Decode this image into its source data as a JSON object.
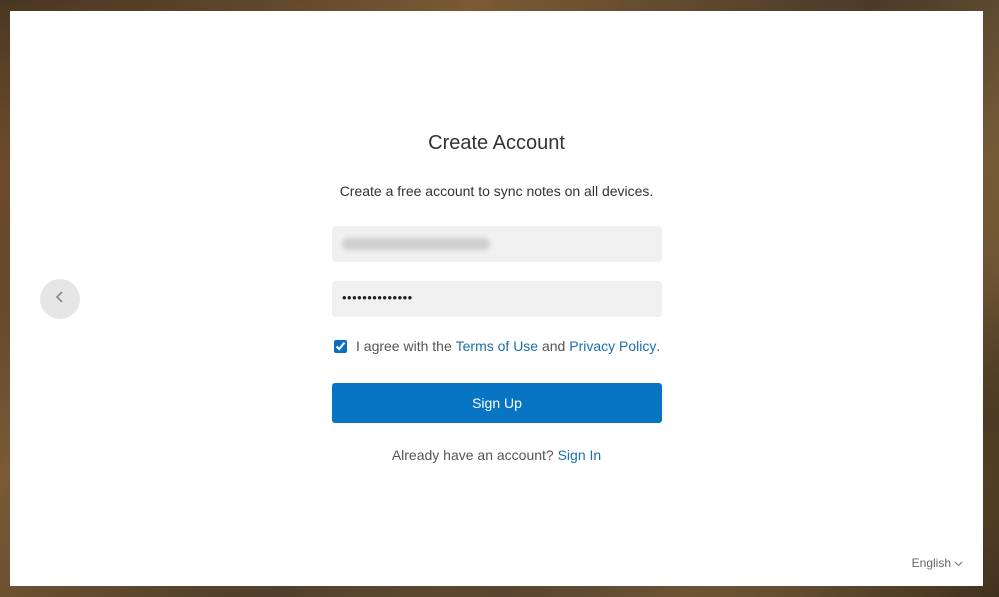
{
  "dialog": {
    "title": "Create Account",
    "subtitle": "Create a free account to sync notes on all devices.",
    "email_field": {
      "value": "",
      "state": "blurred"
    },
    "password_field": {
      "value": "••••••••••••••"
    },
    "agreement": {
      "checked": true,
      "prefix": "I agree with the ",
      "terms_label": "Terms of Use",
      "middle": " and ",
      "privacy_label": "Privacy Policy",
      "suffix": "."
    },
    "signup_label": "Sign Up",
    "signin_prompt": "Already have an account? ",
    "signin_label": "Sign In",
    "language": "English"
  },
  "icons": {
    "back": "chevron-left-icon",
    "language": "chevron-down-icon"
  },
  "colors": {
    "accent": "#0774c4",
    "link": "#1a6fae",
    "field_bg": "#f0f0f0"
  }
}
